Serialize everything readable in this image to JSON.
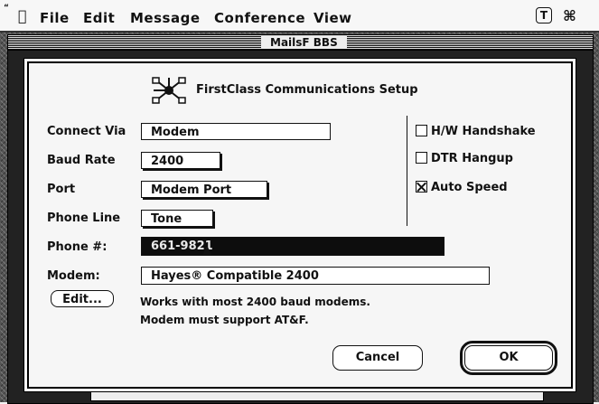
{
  "menubar": {
    "apple_icon": "apple-icon",
    "items": [
      "File",
      "Edit",
      "Message",
      "Conference",
      "View"
    ],
    "right_icons": [
      "help-icon",
      "application-icon"
    ],
    "right_glyphs": [
      "T",
      "⌘"
    ]
  },
  "background_window": {
    "title": "MailsF BBS"
  },
  "dialog": {
    "title": "FirstClass Communications Setup",
    "connect_via": {
      "label": "Connect Via",
      "value": "Modem"
    },
    "baud_rate": {
      "label": "Baud Rate",
      "value": "2400"
    },
    "port": {
      "label": "Port",
      "value": "Modem Port"
    },
    "phone_line": {
      "label": "Phone Line",
      "value": "Tone"
    },
    "phone_number": {
      "label": "Phone #:",
      "value": "661-9821"
    },
    "modem": {
      "label": "Modem:",
      "value": "Hayes® Compatible 2400"
    },
    "edit_button": "Edit...",
    "note_line1": "Works with most 2400 baud modems.",
    "note_line2": "Modem must support AT&F.",
    "checkboxes": [
      {
        "label": "H/W Handshake",
        "checked": false
      },
      {
        "label": "DTR Hangup",
        "checked": false
      },
      {
        "label": "Auto Speed",
        "checked": true
      }
    ],
    "cancel_button": "Cancel",
    "ok_button": "OK"
  }
}
